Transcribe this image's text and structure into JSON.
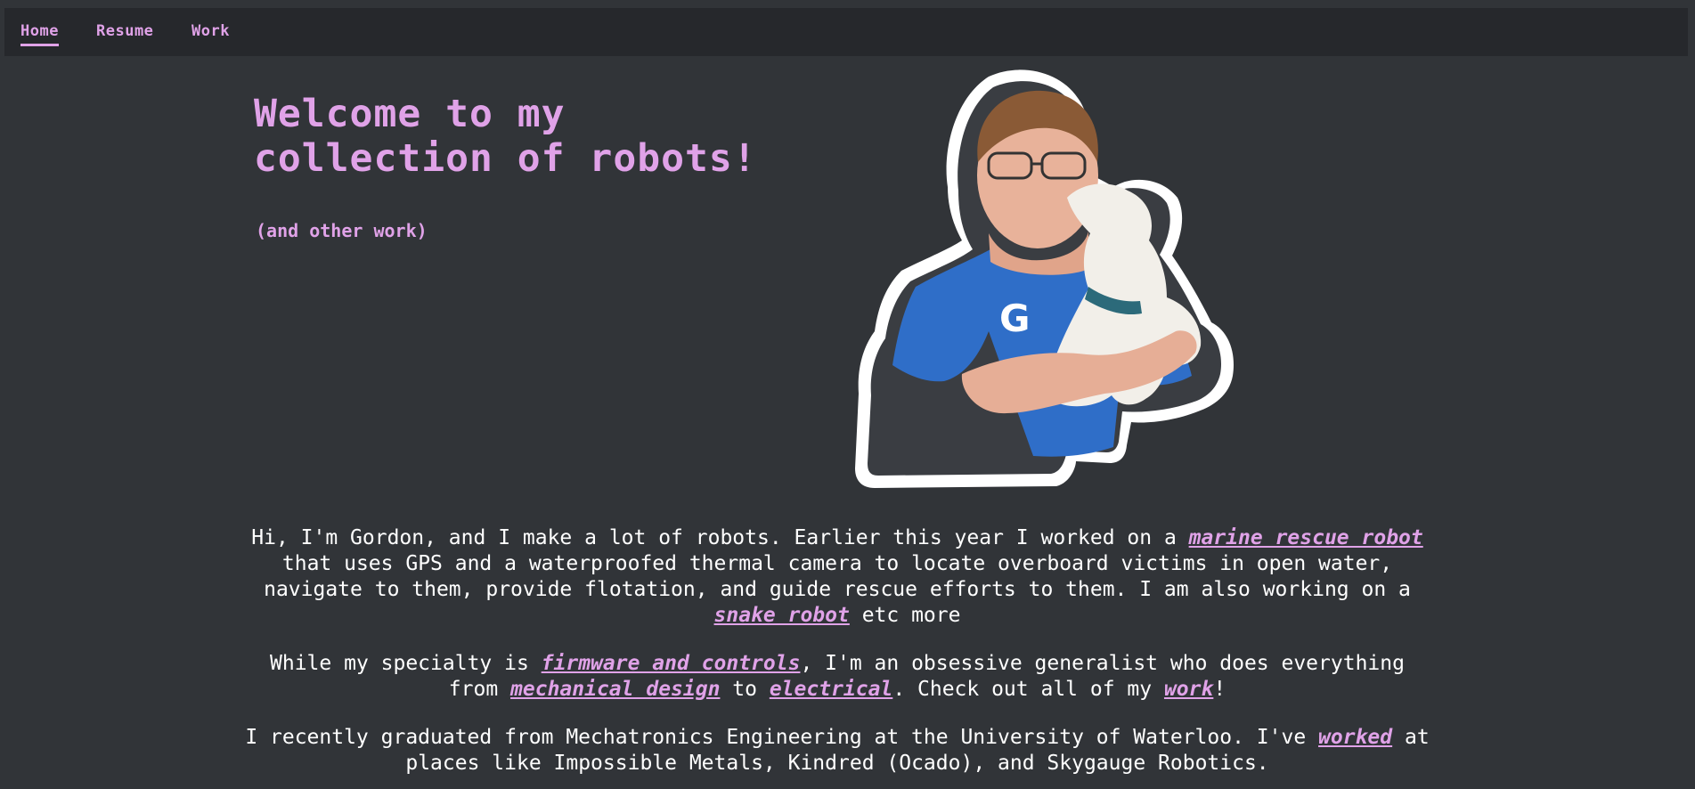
{
  "nav": {
    "items": [
      {
        "label": "Home"
      },
      {
        "label": "Resume"
      },
      {
        "label": "Work"
      }
    ]
  },
  "hero": {
    "title_line1": "Welcome to my",
    "title_line2": "collection of robots!",
    "subtitle": "(and other work)"
  },
  "intro": {
    "p1": {
      "t1": "Hi, I'm Gordon, and I make a lot of robots. Earlier this year I worked on a ",
      "link1": "marine rescue robot",
      "t2": " that uses GPS and a waterproofed thermal camera to locate overboard victims in open water, navigate to them, provide flotation, and guide rescue efforts to them. I am also working on a ",
      "link2": "snake robot",
      "t3": " etc more"
    },
    "p2": {
      "t1": "While my specialty is ",
      "link1": "firmware and controls",
      "t2": ", I'm an obsessive generalist who does everything from ",
      "link2": "mechanical design",
      "t3": " to ",
      "link3": "electrical",
      "t4": ". Check out all of my ",
      "link4": "work",
      "t5": "!"
    },
    "p3": {
      "t1": "I recently graduated from Mechatronics Engineering at the University of Waterloo. I've ",
      "link1": "worked",
      "t2": " at places like Impossible Metals, Kindred (Ocado), and Skygauge Robotics."
    }
  },
  "colors": {
    "background": "#313438",
    "navbar": "#26282c",
    "accent": "#e0a2e8",
    "text": "#ffffff",
    "shirt": "#2f6ec8"
  },
  "photo": {
    "shirt_text": "G"
  }
}
